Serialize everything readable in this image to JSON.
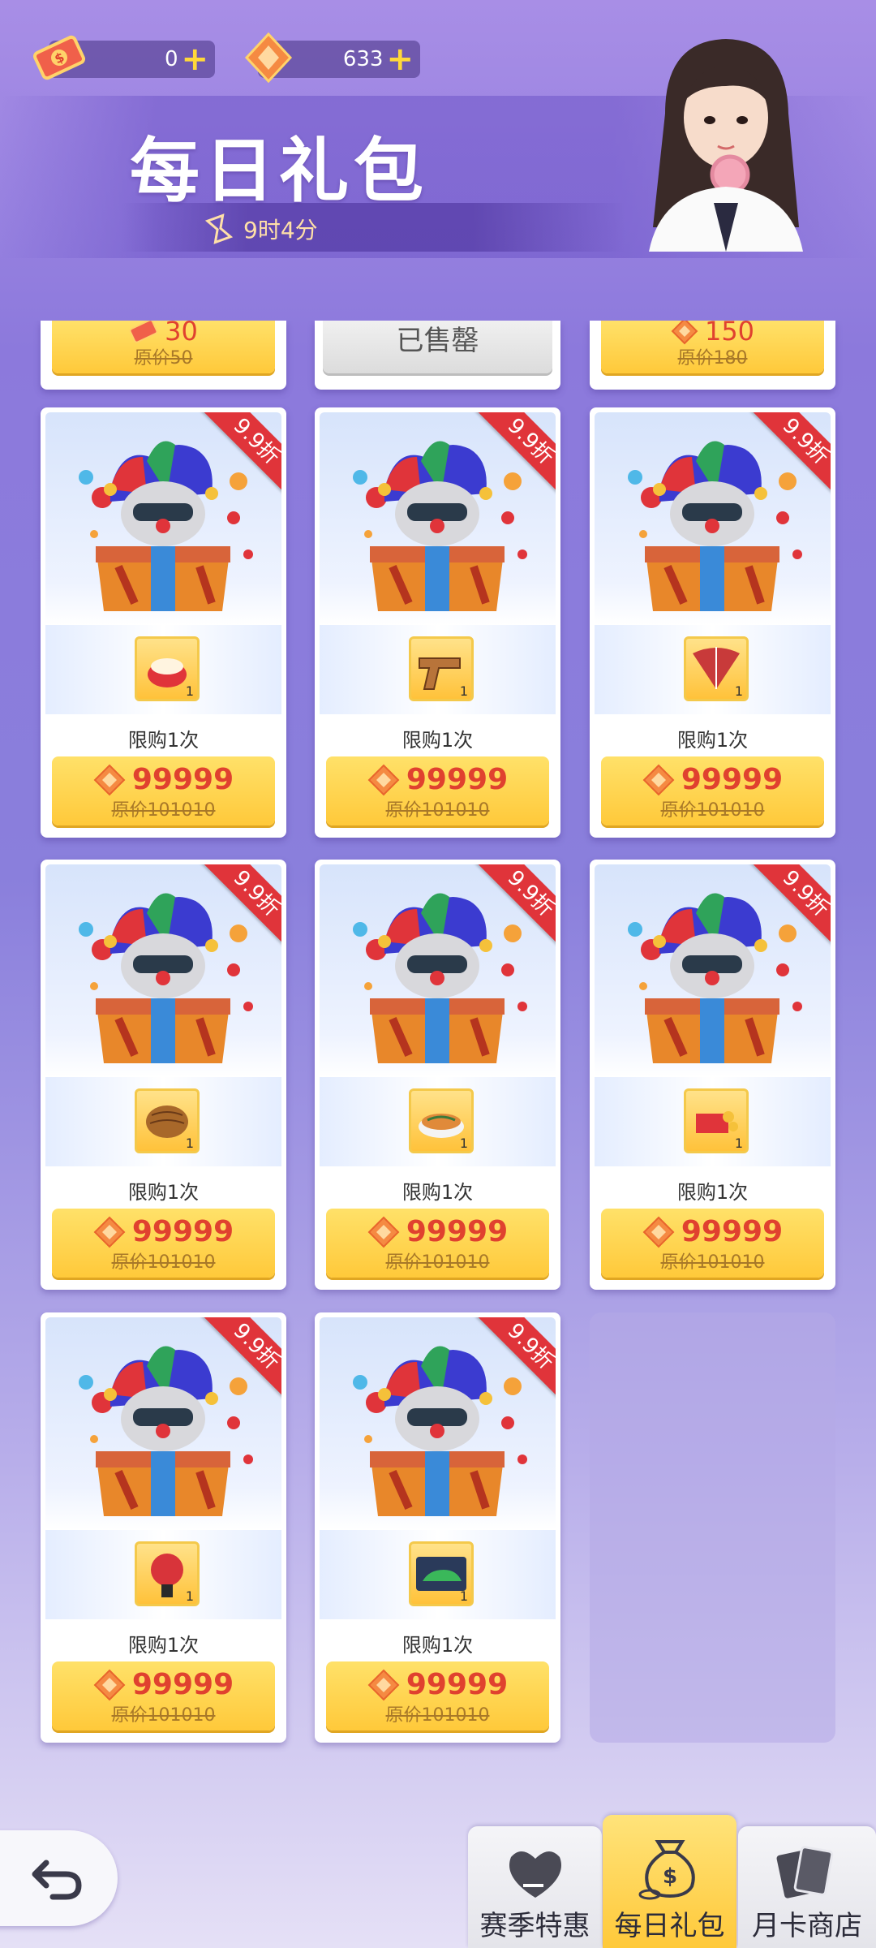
{
  "header": {
    "ticket_balance": "0",
    "gem_balance": "633",
    "title": "每日礼包",
    "timer": "9时4分"
  },
  "partial_row": [
    {
      "price": "30",
      "original": "原价50",
      "currency": "ticket"
    },
    {
      "sold_out_label": "已售罄"
    },
    {
      "price": "150",
      "original": "原价180",
      "currency": "gem"
    }
  ],
  "packs": [
    {
      "discount": "9.9折",
      "item": "rice-bowl-icon",
      "qty": "1",
      "limit": "限购1次",
      "price": "99999",
      "original": "原价101010"
    },
    {
      "discount": "9.9折",
      "item": "pistol-icon",
      "qty": "1",
      "limit": "限购1次",
      "price": "99999",
      "original": "原价101010"
    },
    {
      "discount": "9.9折",
      "item": "fan-icon",
      "qty": "1",
      "limit": "限购1次",
      "price": "99999",
      "original": "原价101010"
    },
    {
      "discount": "9.9折",
      "item": "shell-icon",
      "qty": "1",
      "limit": "限购1次",
      "price": "99999",
      "original": "原价101010"
    },
    {
      "discount": "9.9折",
      "item": "noodle-bowl-icon",
      "qty": "1",
      "limit": "限购1次",
      "price": "99999",
      "original": "原价101010"
    },
    {
      "discount": "9.9折",
      "item": "red-envelope-icon",
      "qty": "1",
      "limit": "限购1次",
      "price": "99999",
      "original": "原价101010"
    },
    {
      "discount": "9.9折",
      "item": "bowling-ball-icon",
      "qty": "1",
      "limit": "限购1次",
      "price": "99999",
      "original": "原价101010"
    },
    {
      "discount": "9.9折",
      "item": "car-card-icon",
      "qty": "1",
      "limit": "限购1次",
      "price": "99999",
      "original": "原价101010"
    }
  ],
  "nav": {
    "tabs": [
      {
        "label": "赛季特惠",
        "icon": "heart-hand-icon",
        "active": false
      },
      {
        "label": "每日礼包",
        "icon": "money-bag-icon",
        "active": true
      },
      {
        "label": "月卡商店",
        "icon": "cards-icon",
        "active": false
      }
    ]
  },
  "colors": {
    "accent_yellow": "#ffc93a",
    "price_red": "#e0412f",
    "ribbon_red": "#e0343a",
    "background_purple": "#8c79dc"
  }
}
